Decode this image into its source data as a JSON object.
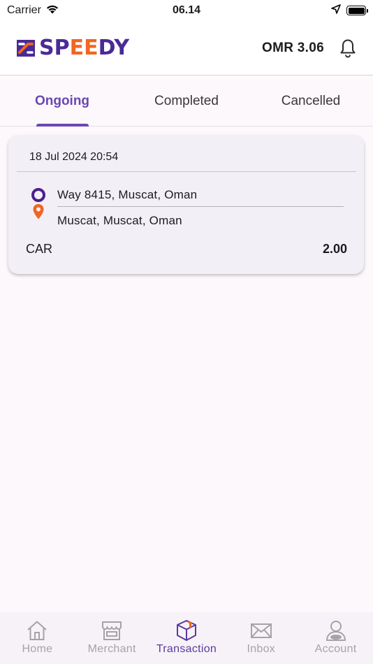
{
  "status_bar": {
    "carrier": "Carrier",
    "time": "06.14"
  },
  "header": {
    "logo_text_a": "SP",
    "logo_text_b": "EE",
    "logo_text_c": "DY",
    "balance": "OMR 3.06",
    "icons": {
      "notifications": "bell-icon"
    }
  },
  "tabs": [
    {
      "label": "Ongoing",
      "active": true
    },
    {
      "label": "Completed",
      "active": false
    },
    {
      "label": "Cancelled",
      "active": false
    }
  ],
  "transactions": [
    {
      "datetime": "18 Jul 2024 20:54",
      "pickup": "Way 8415, Muscat, Oman",
      "dropoff": "Muscat, Muscat, Oman",
      "vehicle": "CAR",
      "fare": "2.00"
    }
  ],
  "bottom_nav": [
    {
      "label": "Home",
      "icon": "home-icon",
      "active": false
    },
    {
      "label": "Merchant",
      "icon": "store-icon",
      "active": false
    },
    {
      "label": "Transaction",
      "icon": "package-icon",
      "active": true
    },
    {
      "label": "Inbox",
      "icon": "envelope-icon",
      "active": false
    },
    {
      "label": "Account",
      "icon": "user-icon",
      "active": false
    }
  ],
  "colors": {
    "brand_purple": "#4a2a96",
    "brand_orange": "#f26522",
    "accent": "#6b47b0",
    "background": "#fdf8fc",
    "card": "#f3eff6"
  }
}
